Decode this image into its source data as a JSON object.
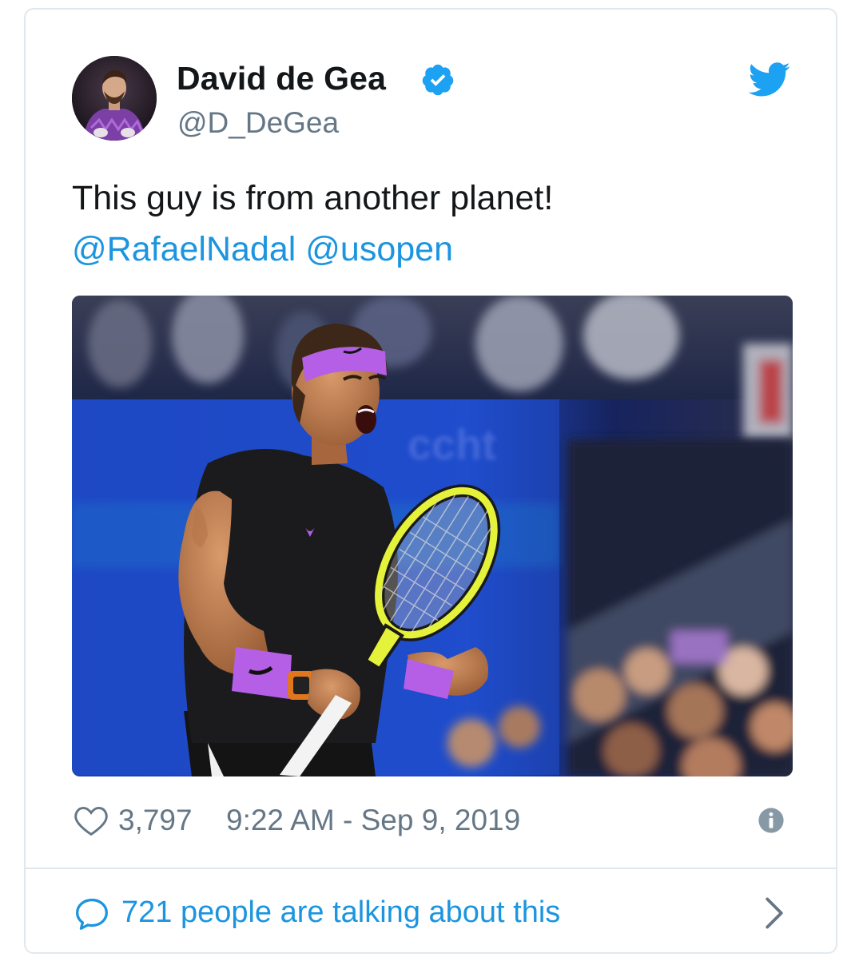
{
  "tweet": {
    "author": {
      "display_name": "David de Gea",
      "handle": "@D_DeGea",
      "verified": true,
      "avatar_icon": "avatar-photo"
    },
    "text": "This guy is from another planet!",
    "mentions": [
      "@RafaelNadal",
      "@usopen"
    ],
    "photo": {
      "alt": "photo-of-tennis-player-celebrating"
    },
    "likes": "3,797",
    "timestamp": "9:22 AM - Sep 9, 2019",
    "conversation_text": "721 people are talking about this"
  },
  "colors": {
    "brand": "#1da1f2",
    "link": "#1b95e0",
    "text": "#14171a",
    "muted": "#657786",
    "border": "#e1e8ed"
  },
  "icons": {
    "bird": "twitter-bird-icon",
    "verified": "verified-badge-icon",
    "heart": "heart-icon",
    "info": "info-icon",
    "bubble": "speech-bubble-icon",
    "chevron": "chevron-right-icon"
  }
}
